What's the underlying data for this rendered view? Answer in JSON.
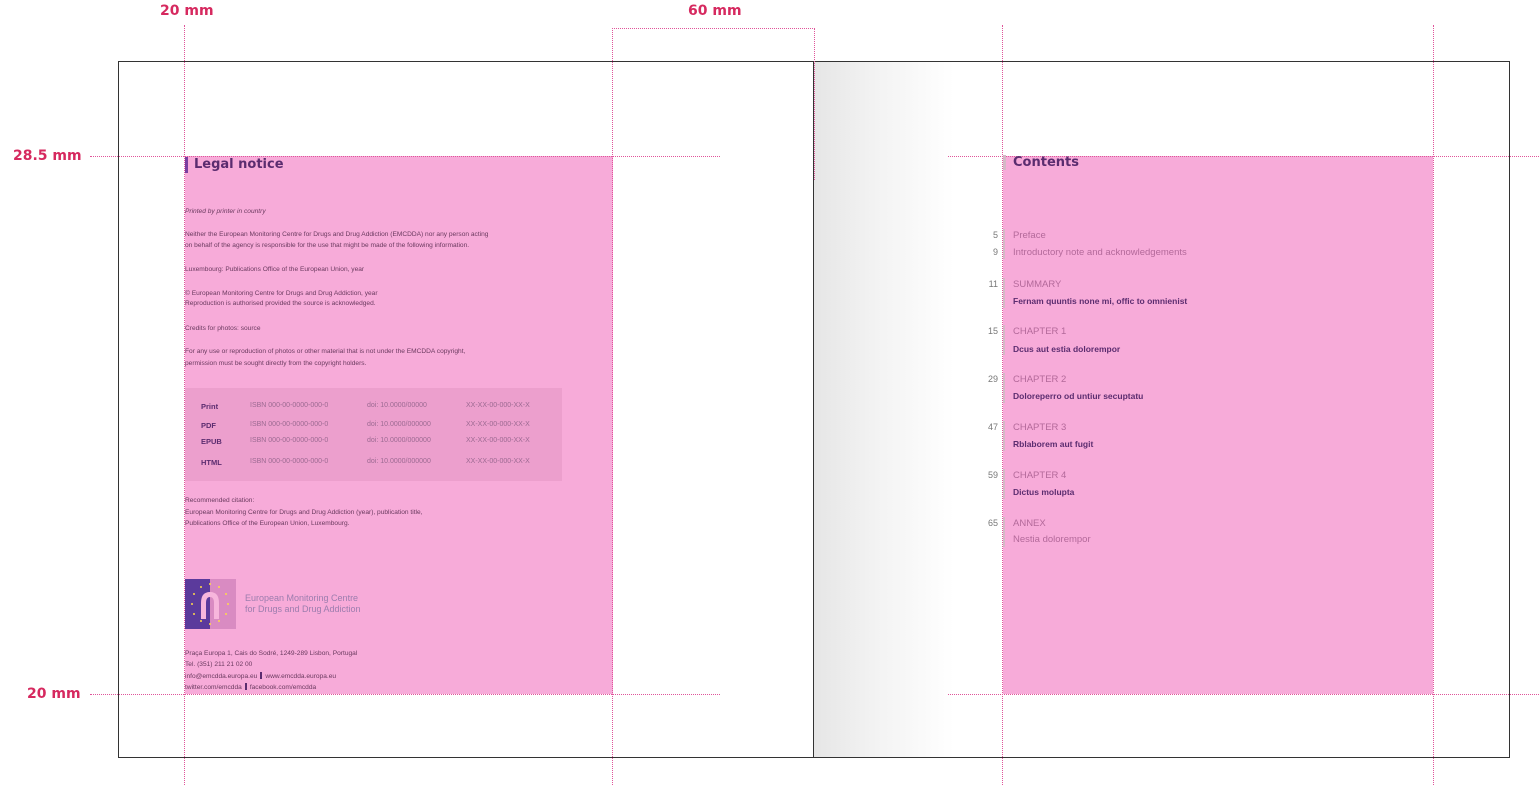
{
  "dimensions": {
    "margin_left": "20 mm",
    "column": "60 mm",
    "margin_top": "28.5 mm",
    "margin_bottom": "20 mm"
  },
  "colors": {
    "text_block": "#f7abd9",
    "guide": "#d6295f",
    "heading": "#5b2c6f"
  },
  "legal": {
    "heading": "Legal notice",
    "printed_by": "Printed by printer in country",
    "disclaimer_1": "Neither the European Monitoring Centre for Drugs and Drug Addiction (EMCDDA) nor any person acting",
    "disclaimer_2": "on behalf of the agency is responsible for the use that might be made of the following information.",
    "luxembourg": "Luxembourg: Publications Office of the European Union, year",
    "copyright_1": "© European Monitoring Centre for Drugs and Drug Addiction, year",
    "copyright_2": "Reproduction is authorised provided the source is acknowledged.",
    "credits": "Credits for photos: source",
    "reuse_1": "For any use or reproduction of photos or other material that is not under the EMCDDA copyright,",
    "reuse_2": "permission must be sought directly from the copyright holders.",
    "isbn_rows": [
      {
        "format": "Print",
        "isbn": "ISBN 000-00-0000-000-0",
        "doi": "doi: 10.0000/00000",
        "catalogue": "XX-XX-00-000-XX-X"
      },
      {
        "format": "PDF",
        "isbn": "ISBN 000-00-0000-000-0",
        "doi": "doi: 10.0000/000000",
        "catalogue": "XX-XX-00-000-XX-X"
      },
      {
        "format": "EPUB",
        "isbn": "ISBN 000-00-0000-000-0",
        "doi": "doi: 10.0000/000000",
        "catalogue": "XX-XX-00-000-XX-X"
      },
      {
        "format": "HTML",
        "isbn": "ISBN 000-00-0000-000-0",
        "doi": "doi: 10.0000/000000",
        "catalogue": "XX-XX-00-000-XX-X"
      }
    ],
    "citation_1": "Recommended citation:",
    "citation_2": "European Monitoring Centre for Drugs and Drug Addiction (year), publication title,",
    "citation_3": "Publications Office of the European Union, Luxembourg.",
    "org_line_1": "European Monitoring Centre",
    "org_line_2": "for Drugs and Drug Addiction",
    "address": "Praça Europa 1, Cais do Sodré, 1249-289 Lisbon, Portugal",
    "tel": "Tel. (351) 211 21 02 00",
    "email": "info@emcdda.europa.eu",
    "website": "www.emcdda.europa.eu",
    "twitter": "twitter.com/emcdda",
    "facebook": "facebook.com/emcdda"
  },
  "contents": {
    "heading": "Contents",
    "items": [
      {
        "page": "5",
        "label": "Preface"
      },
      {
        "page": "9",
        "label": "Introductory note and acknowledgements"
      },
      {
        "page": "11",
        "label": "SUMMARY",
        "title": "Fernam quuntis none mi, offic to omnienist"
      },
      {
        "page": "15",
        "label": "CHAPTER 1",
        "title": "Dcus aut estia dolorempor"
      },
      {
        "page": "29",
        "label": "CHAPTER 2",
        "title": "Doloreperro od untiur secuptatu"
      },
      {
        "page": "47",
        "label": "CHAPTER 3",
        "title": "Rblaborem aut fugit"
      },
      {
        "page": "59",
        "label": "CHAPTER 4",
        "title": "Dictus molupta"
      },
      {
        "page": "65",
        "label": "ANNEX",
        "title": "Nestia dolorempor"
      }
    ]
  }
}
